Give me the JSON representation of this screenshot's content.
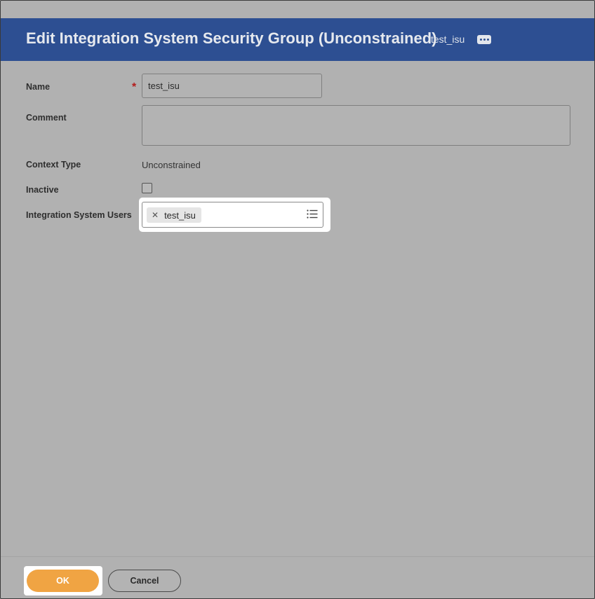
{
  "header": {
    "title": "Edit Integration System Security Group (Unconstrained)",
    "object_name": "test_isu",
    "related_actions_icon": "ellipsis-icon"
  },
  "form": {
    "name": {
      "label": "Name",
      "required_marker": "*",
      "value": "test_isu"
    },
    "comment": {
      "label": "Comment",
      "value": ""
    },
    "context_type": {
      "label": "Context Type",
      "value": "Unconstrained"
    },
    "inactive": {
      "label": "Inactive",
      "checked": false
    },
    "integration_system_users": {
      "label": "Integration System Users",
      "selected": [
        {
          "label": "test_isu",
          "remove_icon": "close-icon"
        }
      ],
      "prompt_icon": "list-icon"
    }
  },
  "footer": {
    "ok_label": "OK",
    "cancel_label": "Cancel"
  },
  "colors": {
    "header_bg": "#2d4f92",
    "overlay_bg": "#b1b1b1",
    "ok_button": "#f0a443",
    "required": "#b41c1c"
  }
}
